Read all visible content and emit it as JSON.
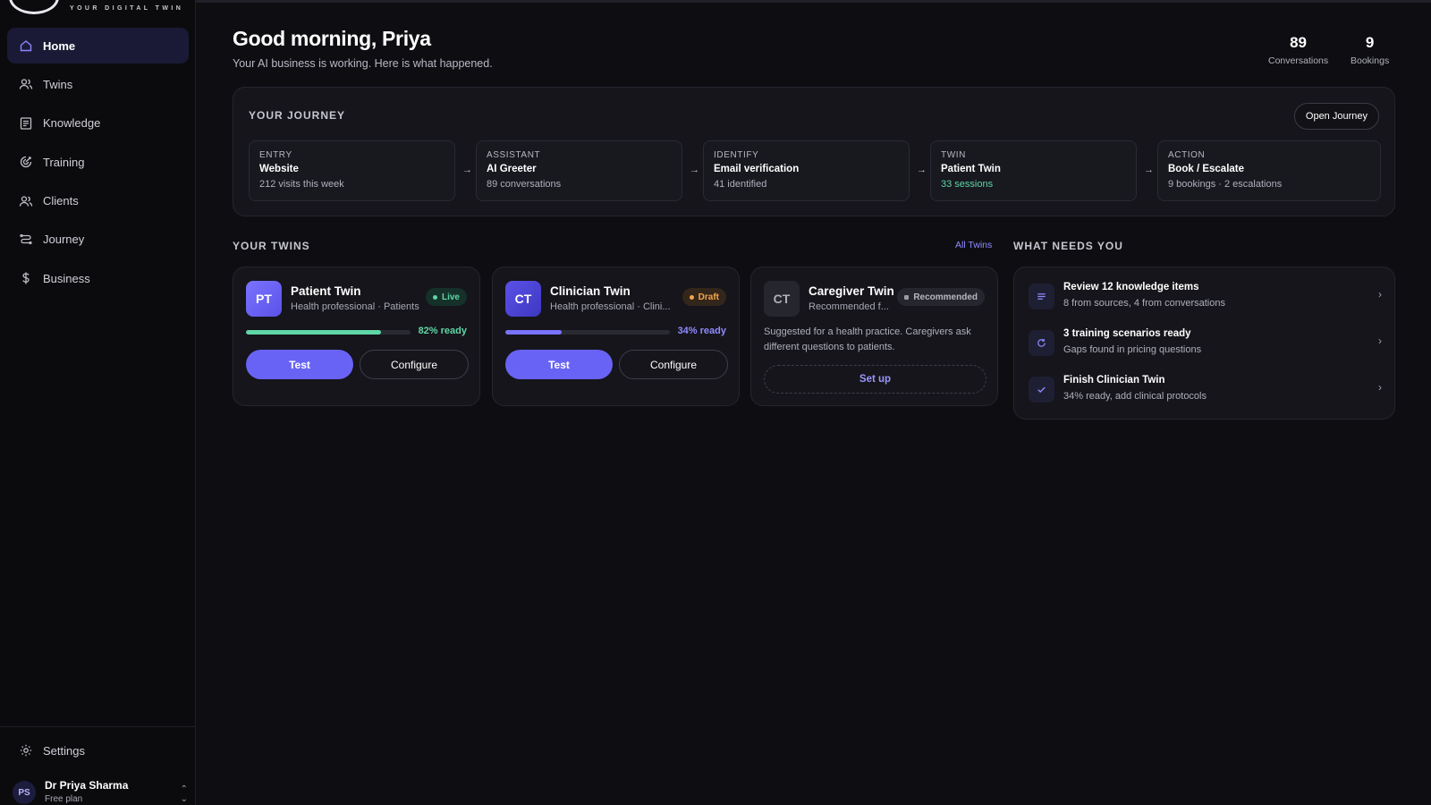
{
  "brand": {
    "tagline": "YOUR DIGITAL TWIN"
  },
  "sidebar": {
    "items": [
      {
        "label": "Home",
        "icon": "home-icon",
        "active": true
      },
      {
        "label": "Twins",
        "icon": "users-icon"
      },
      {
        "label": "Knowledge",
        "icon": "book-icon"
      },
      {
        "label": "Training",
        "icon": "target-icon"
      },
      {
        "label": "Clients",
        "icon": "people-icon"
      },
      {
        "label": "Journey",
        "icon": "route-icon"
      },
      {
        "label": "Business",
        "icon": "dollar-icon"
      }
    ],
    "settings_label": "Settings",
    "user": {
      "initials": "PS",
      "name": "Dr Priya Sharma",
      "plan": "Free plan"
    }
  },
  "header": {
    "greeting": "Good morning, Priya",
    "subtitle": "Your AI business is working. Here is what happened.",
    "stats": [
      {
        "value": "89",
        "label": "Conversations"
      },
      {
        "value": "9",
        "label": "Bookings"
      }
    ]
  },
  "journey": {
    "title": "YOUR JOURNEY",
    "open_label": "Open Journey",
    "steps": [
      {
        "kind": "ENTRY",
        "title": "Website",
        "detail": "212 visits this week"
      },
      {
        "kind": "ASSISTANT",
        "title": "AI Greeter",
        "detail": "89 conversations"
      },
      {
        "kind": "IDENTIFY",
        "title": "Email verification",
        "detail": "41 identified"
      },
      {
        "kind": "TWIN",
        "title": "Patient Twin",
        "detail": "33 sessions"
      },
      {
        "kind": "ACTION",
        "title": "Book / Escalate",
        "detail": "9 bookings · 2 escalations"
      }
    ]
  },
  "twins": {
    "title": "YOUR TWINS",
    "all_label": "All Twins",
    "cards": [
      {
        "initials": "PT",
        "name": "Patient Twin",
        "sub": "Health professional · Patients",
        "badge": "Live",
        "ready_label": "82% ready",
        "ready": 0.82,
        "test_label": "Test",
        "configure_label": "Configure"
      },
      {
        "initials": "CT",
        "name": "Clinician Twin",
        "sub": "Health professional · Clini...",
        "badge": "Draft",
        "ready_label": "34% ready",
        "ready": 0.34,
        "test_label": "Test",
        "configure_label": "Configure"
      },
      {
        "initials": "CT",
        "name": "Caregiver Twin",
        "sub": "Recommended f...",
        "badge": "Recommended",
        "description": "Suggested for a health practice. Caregivers ask different questions to patients.",
        "setup_label": "Set up"
      }
    ]
  },
  "needs": {
    "title": "WHAT NEEDS YOU",
    "items": [
      {
        "icon": "list-icon",
        "title": "Review 12 knowledge items",
        "sub": "8 from sources, 4 from conversations"
      },
      {
        "icon": "refresh-icon",
        "title": "3 training scenarios ready",
        "sub": "Gaps found in pricing questions"
      },
      {
        "icon": "check-icon",
        "title": "Finish Clinician Twin",
        "sub": "34% ready, add clinical protocols"
      }
    ]
  },
  "colors": {
    "accent": "#6963f5",
    "live": "#5fd6a6",
    "draft": "#f5a54a",
    "link": "#8f8aff"
  }
}
